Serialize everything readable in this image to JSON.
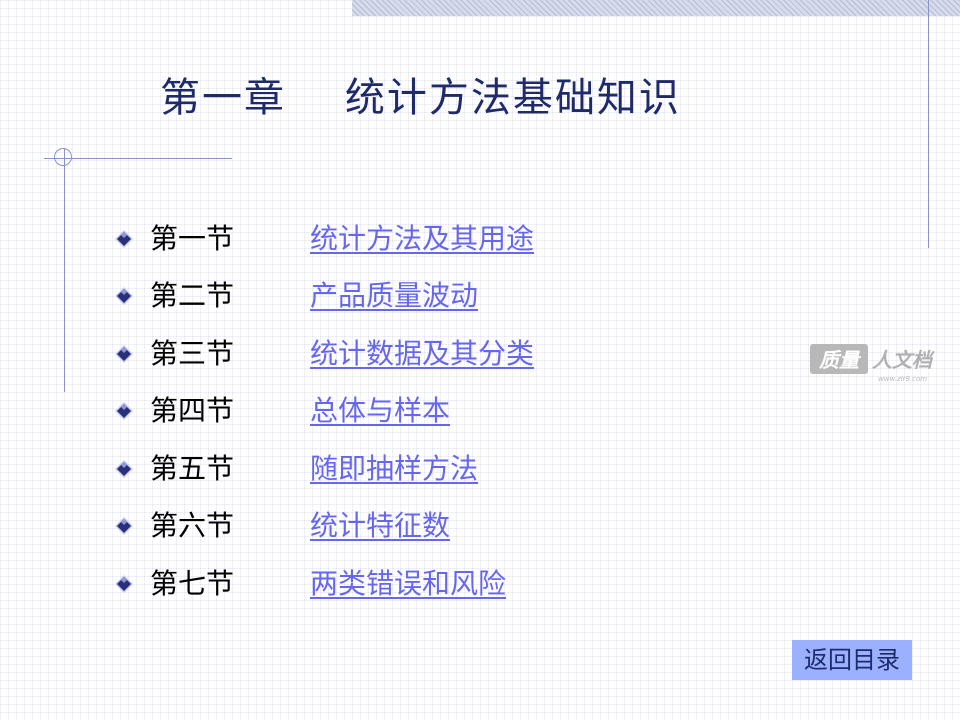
{
  "title": "第一章    统计方法基础知识",
  "sections": [
    {
      "no": "第一节",
      "link": "统计方法及其用途"
    },
    {
      "no": "第二节",
      "link": "产品质量波动"
    },
    {
      "no": "第三节",
      "link": "统计数据及其分类"
    },
    {
      "no": "第四节",
      "link": "总体与样本"
    },
    {
      "no": "第五节",
      "link": "随即抽样方法"
    },
    {
      "no": "第六节",
      "link": "统计特征数"
    },
    {
      "no": "第七节",
      "link": "两类错误和风险"
    }
  ],
  "watermark": {
    "brand": "质量人文档",
    "site": "www.zlr9.com"
  },
  "back_button": "返回目录",
  "colors": {
    "title": "#1f2a6b",
    "link": "#6666ee",
    "button_bg": "#9bb0ff",
    "bullet_dark": "#2a2f7a",
    "bullet_light": "#c9ccf2"
  }
}
